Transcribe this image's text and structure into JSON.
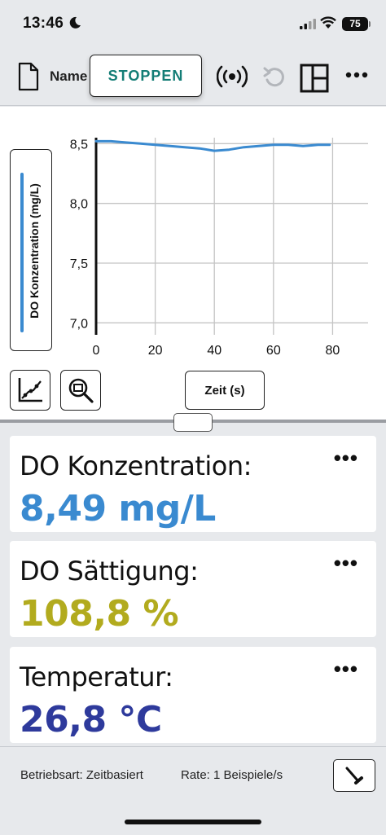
{
  "status": {
    "time": "13:46",
    "battery": "75"
  },
  "toolbar": {
    "file_name": "Name",
    "stop_label": "STOPPEN",
    "icons": [
      "file-icon",
      "sensor-broadcast-icon",
      "undo-icon",
      "layout-icon",
      "more-icon"
    ]
  },
  "graph": {
    "y_axis_label": "DO Konzentration (mg/L)",
    "x_axis_label": "Zeit (s)",
    "tools": [
      "curve-fit-icon",
      "zoom-icon"
    ]
  },
  "chart_data": {
    "type": "line",
    "xlabel": "Zeit (s)",
    "ylabel": "DO Konzentration (mg/L)",
    "xlim": [
      0,
      92
    ],
    "ylim": [
      6.9,
      8.55
    ],
    "x_ticks": [
      "0",
      "20",
      "40",
      "60",
      "80"
    ],
    "x_tick_values": [
      0,
      20,
      40,
      60,
      80
    ],
    "y_ticks": [
      "7,0",
      "7,5",
      "8,0",
      "8,5"
    ],
    "y_tick_values": [
      7.0,
      7.5,
      8.0,
      8.5
    ],
    "grid": true,
    "series_color": "#3a8ad0",
    "series": [
      {
        "x": [
          0,
          5,
          10,
          15,
          20,
          25,
          30,
          35,
          40,
          45,
          50,
          55,
          60,
          65,
          70,
          75,
          79
        ],
        "y": [
          8.52,
          8.52,
          8.51,
          8.5,
          8.49,
          8.48,
          8.47,
          8.46,
          8.44,
          8.45,
          8.47,
          8.48,
          8.49,
          8.49,
          8.48,
          8.49,
          8.49
        ]
      }
    ]
  },
  "meters": [
    {
      "title": "DO Konzentration:",
      "value": "8,49 mg/L",
      "color": "#3a8ad0",
      "more": "•••"
    },
    {
      "title": "DO Sättigung:",
      "value": "108,8 %",
      "color": "#b2ab1e",
      "more": "•••"
    },
    {
      "title": "Temperatur:",
      "value": "26,8 °C",
      "color": "#2e3a9c",
      "more": "•••"
    }
  ],
  "footer": {
    "mode": "Betriebsart: Zeitbasiert",
    "rate": "Rate: 1 Beispiele/s"
  }
}
